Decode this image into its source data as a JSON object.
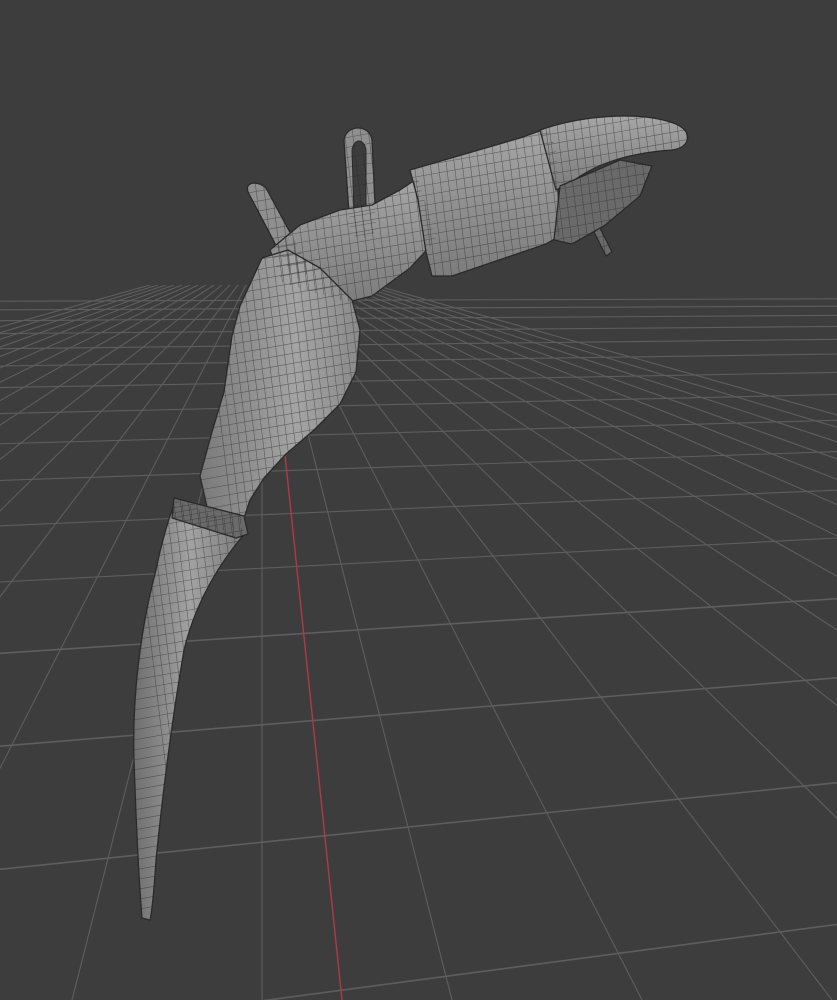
{
  "viewport": {
    "background_color": "#3d3d3d",
    "grid_color": "#5e5e5e",
    "horizon_color": "#474747",
    "x_axis_color": "#b03a48",
    "model_fill_color": "#8f8f8f",
    "model_wire_color": "#2a2a2a",
    "object": "claw-weapon-mesh",
    "shading": "solid-with-wireframe",
    "floor_grid": true,
    "axis_line_visible": "x"
  }
}
